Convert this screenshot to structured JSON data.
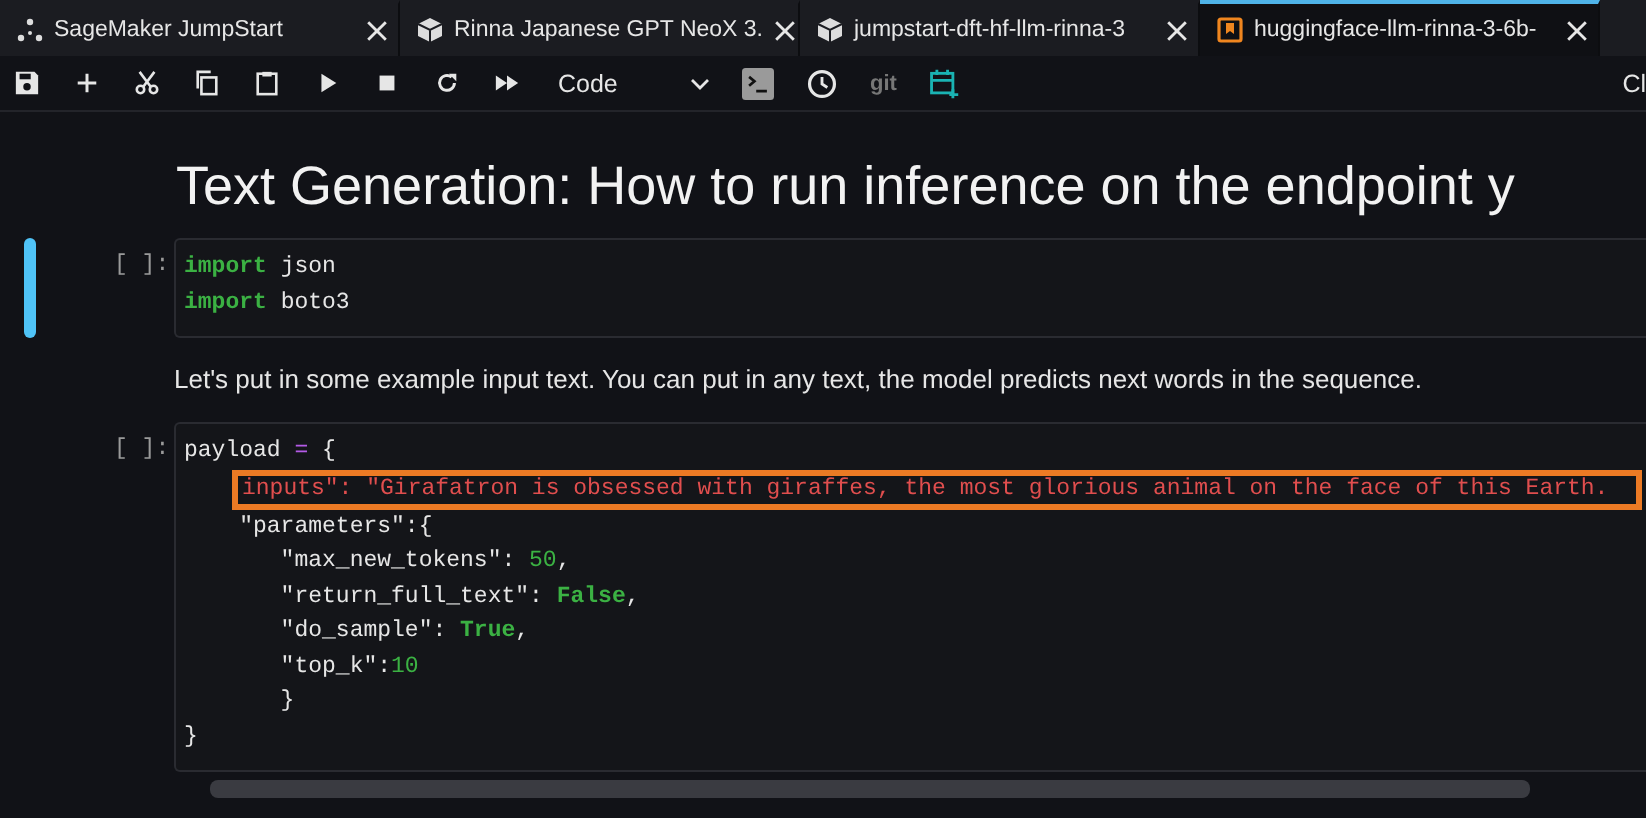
{
  "tabs": [
    {
      "kind": "jumpstart",
      "label": "SageMaker JumpStart",
      "selected": false
    },
    {
      "kind": "model",
      "label": "Rinna Japanese GPT NeoX 3.",
      "selected": false
    },
    {
      "kind": "model",
      "label": "jumpstart-dft-hf-llm-rinna-3",
      "selected": false
    },
    {
      "kind": "notebook",
      "label": "huggingface-llm-rinna-3-6b-",
      "selected": true
    }
  ],
  "toolbar": {
    "buttons": [
      {
        "kind": "save"
      },
      {
        "kind": "add"
      },
      {
        "kind": "cut"
      },
      {
        "kind": "copy"
      },
      {
        "kind": "paste"
      },
      {
        "kind": "run"
      },
      {
        "kind": "stop"
      },
      {
        "kind": "restart"
      },
      {
        "kind": "run-all"
      }
    ],
    "cell_type": "Code",
    "tools": [
      {
        "kind": "terminal"
      },
      {
        "kind": "clock"
      },
      {
        "kind": "git",
        "label": "git"
      },
      {
        "kind": "calendar"
      }
    ],
    "right_text": "Cl"
  },
  "notebook": {
    "title": "Text Generation: How to run inference on the endpoint y",
    "cells": [
      {
        "kind": "code",
        "prompt": "[ ]:",
        "active": true,
        "lines": [
          [
            {
              "kind": "keyword",
              "text": "import"
            },
            {
              "kind": "plain",
              "text": " json"
            }
          ],
          [
            {
              "kind": "keyword",
              "text": "import"
            },
            {
              "kind": "plain",
              "text": " boto3"
            }
          ]
        ]
      },
      {
        "kind": "markdown",
        "text": "Let's put in some example input text. You can put in any text, the model predicts next words in the sequence."
      },
      {
        "kind": "code",
        "prompt": "[ ]:",
        "active": false,
        "lines": [
          [
            {
              "kind": "plain",
              "text": "payload "
            },
            {
              "kind": "operator",
              "text": "="
            },
            {
              "kind": "plain",
              "text": " {"
            }
          ],
          [
            {
              "kind": "string",
              "text": "inputs\": \"Girafatron is obsessed with giraffes, the most glorious animal on the face of this Earth.",
              "highlighted": true
            }
          ],
          [
            {
              "kind": "plain",
              "text": "    \"parameters\":{"
            }
          ],
          [
            {
              "kind": "plain",
              "text": "       \"max_new_tokens\": "
            },
            {
              "kind": "number",
              "text": "50"
            },
            {
              "kind": "plain",
              "text": ","
            }
          ],
          [
            {
              "kind": "plain",
              "text": "       \"return_full_text\": "
            },
            {
              "kind": "constant",
              "text": "False"
            },
            {
              "kind": "plain",
              "text": ","
            }
          ],
          [
            {
              "kind": "plain",
              "text": "       \"do_sample\": "
            },
            {
              "kind": "constant",
              "text": "True"
            },
            {
              "kind": "plain",
              "text": ","
            }
          ],
          [
            {
              "kind": "plain",
              "text": "       \"top_k\":"
            },
            {
              "kind": "number",
              "text": "10"
            }
          ],
          [
            {
              "kind": "plain",
              "text": "       }"
            }
          ],
          [
            {
              "kind": "plain",
              "text": "}"
            }
          ]
        ]
      }
    ]
  }
}
